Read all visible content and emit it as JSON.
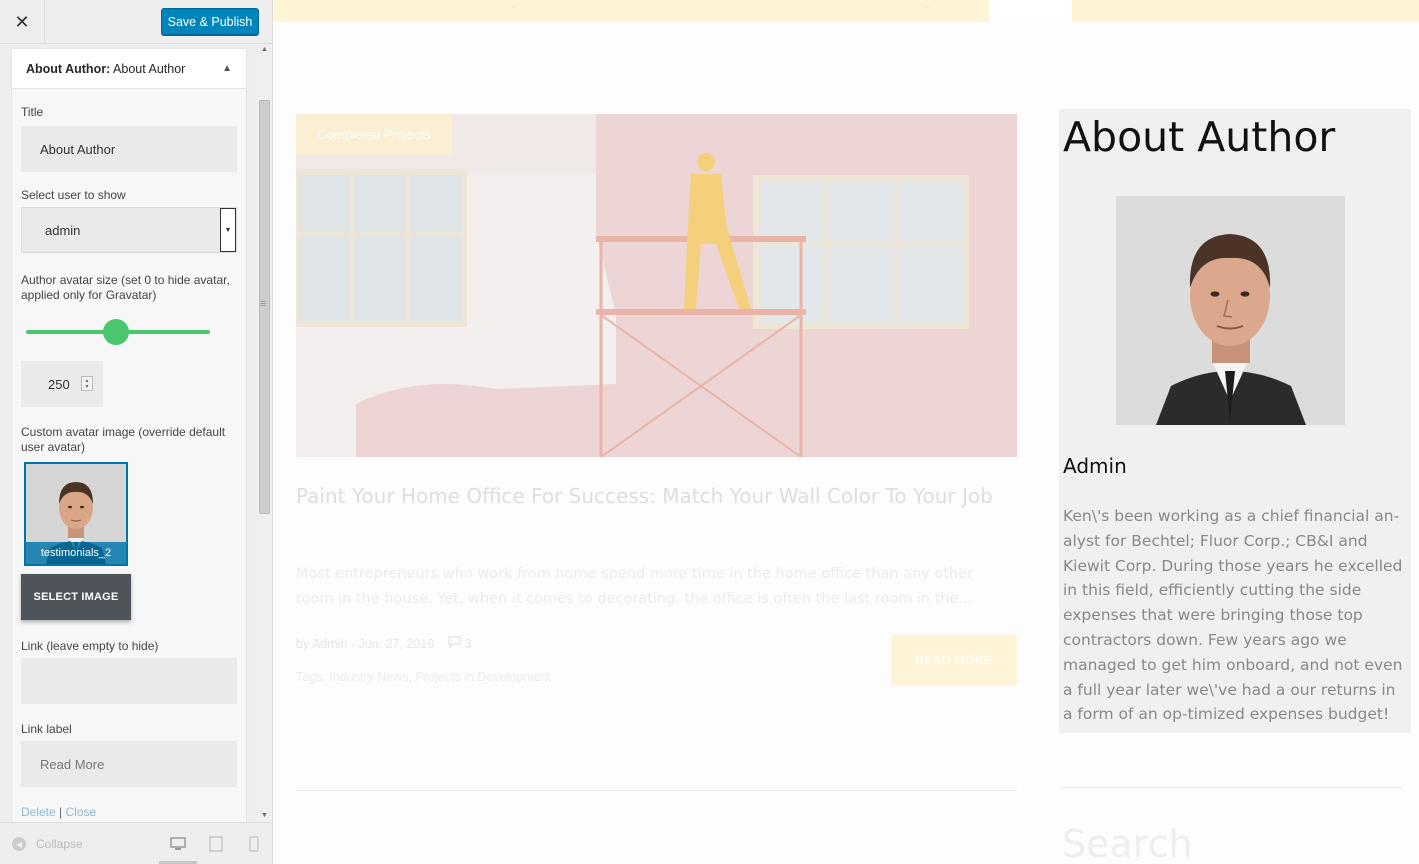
{
  "customizer": {
    "close_icon": "close-icon",
    "publish_label": "Save & Publish",
    "widget": {
      "title": "About Author:",
      "instance": "About Author",
      "title_label": "Title",
      "title_value": "About Author",
      "user_label": "Select user to show",
      "user_value": "admin",
      "avatar_size_label": "Author avatar size (set 0 to hide avatar, applied only for Gravatar)",
      "avatar_size_value": "250",
      "avatar_size_slider_fraction": 0.49,
      "custom_avatar_label": "Custom avatar image (override default user avatar)",
      "avatar_filename": "testimonials_2",
      "select_image_label": "SELECT IMAGE",
      "link_label": "Link (leave empty to hide)",
      "link_value": "",
      "link_label_label": "Link label",
      "link_label_value": "Read More",
      "delete_label": "Delete",
      "close_label": "Close"
    },
    "footer": {
      "collapse_label": "Collapse"
    },
    "colors": {
      "primary": "#0085ba",
      "slider": "#4ac66e",
      "select_image_bg": "#4e545a"
    }
  },
  "preview": {
    "post": {
      "category": "Completed Projects",
      "title": "Paint Your Home Office For Success: Match Your Wall Color To Your Job",
      "excerpt": "Most entrepreneurs who work from home spend more time in the home office than any other room in the house. Yet, when it comes to decorating, the office is often the last room in the…",
      "byline": "by Admin",
      "date": "Jun. 27, 2016",
      "comments": "3",
      "tags_label": "Tags:",
      "tags": "Industry News, Projects in Development",
      "read_more": "READ MORE"
    },
    "about": {
      "title": "About Author",
      "name": "Admin",
      "bio": "Ken\\'s been working as a chief financial an-alyst for Bechtel; Fluor Corp.; CB&I and Kiewit Corp. During those years he excelled in this field, efficiently cutting the side expenses that were bringing those top contractors down. Few years ago we managed to get him onboard, and not even a full year later we\\'ve had a our returns in a form of an op-timized expenses budget!"
    },
    "search_title": "Search"
  }
}
